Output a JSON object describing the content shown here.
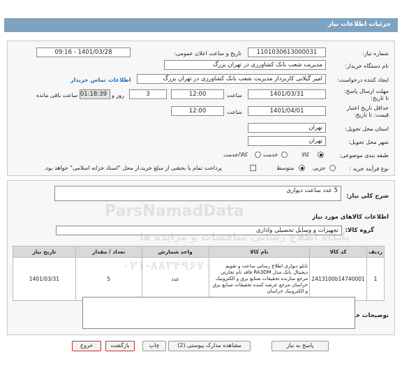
{
  "header": {
    "title": "جزئیات اطلاعات نیاز"
  },
  "form": {
    "need_number_label": "شماره نیاز:",
    "need_number": "1101030613000031",
    "announce_label": "تاریخ و ساعت اعلان عمومی:",
    "announce_value": "1401/03/28 - 09:16",
    "buyer_org_label": "نام دستگاه خریدار:",
    "buyer_org": "مدیریت شعب بانک کشاورزی در تهران بزرگ",
    "creator_label": "ایجاد کننده درخواست:",
    "creator": "امیر گیلانی کاربرداز مدیریت شعب بانک کشاورزی در تهران بزرگ",
    "contact_link": "اطلاعات تماس خریدار",
    "send_deadline_label": "مهلت ارسال پاسخ: تا تاریخ:",
    "send_deadline_date": "1401/03/31",
    "time_label": "ساعت",
    "send_deadline_time": "12:00",
    "days_value": "3",
    "days_label": "روز و",
    "remaining_time": "01:18:39",
    "remaining_label": "ساعت باقی مانده",
    "validity_label": "حداقل تاریخ اعتبار قیمت: تا تاریخ:",
    "validity_date": "1401/04/01",
    "validity_time": "12:00",
    "province_label": "استان محل تحویل:",
    "province": "تهران",
    "city_label": "شهر محل تحویل:",
    "city": "تهران",
    "category_label": "طبقه بندی موضوعی:",
    "category_options": [
      "کالا",
      "خدمت",
      "کالا/خدمت"
    ],
    "process_label": "نوع فرآیند خرید :",
    "process_options": [
      "جزیی",
      "متوسط"
    ],
    "payment_note": "پرداخت تمام یا بخشی از مبلغ خرید،از محل \"اسناد خزانه اسلامی\" خواهد بود."
  },
  "description": {
    "label": "شرح کلی نیاز:",
    "value": "5 عدد ساعت دیواری"
  },
  "goods": {
    "title": "اطلاعات کالاهای مورد نیاز",
    "group_label": "گروه کالا:",
    "group_value": "تجهیزات و وسایل تحصیلی واداری",
    "columns": [
      "ردیف",
      "کد کالا",
      "نام کالا",
      "واحد شمارش",
      "تعداد / مقدار",
      "تاریخ نیاز"
    ],
    "rows": [
      {
        "index": "1",
        "code": "2413100b14740001",
        "name": "تابلو دیواری اطلاع رسانی ساعت و تقویم دیجیتال بانک مدل RA3DM فاقد نام تجارتی مرجع سازنده تحقیقات صنایع برق و الکترونیک خراسان مرجع عرضه کننده تحقیقات صنایع برق و الکترونیک خراسان",
        "unit": "عدد",
        "qty": "5",
        "date": "1401/03/31"
      }
    ]
  },
  "buyer_notes": {
    "label": "توضیحات خریدار:",
    "value": ""
  },
  "buttons": {
    "reply": "پاسخ به نیاز",
    "attachments": "مشاهده مدارک پیوستی (2)",
    "print": "چاپ",
    "back": "بازگشت",
    "exit": "خروج"
  },
  "watermark": {
    "brand": "ParsNamadData",
    "fa": "پایگاه اطلاع رسانی مناقصات و مزایده ها",
    "phone": "۰۲۱-۸۸۳۴۹۶۷۰"
  }
}
